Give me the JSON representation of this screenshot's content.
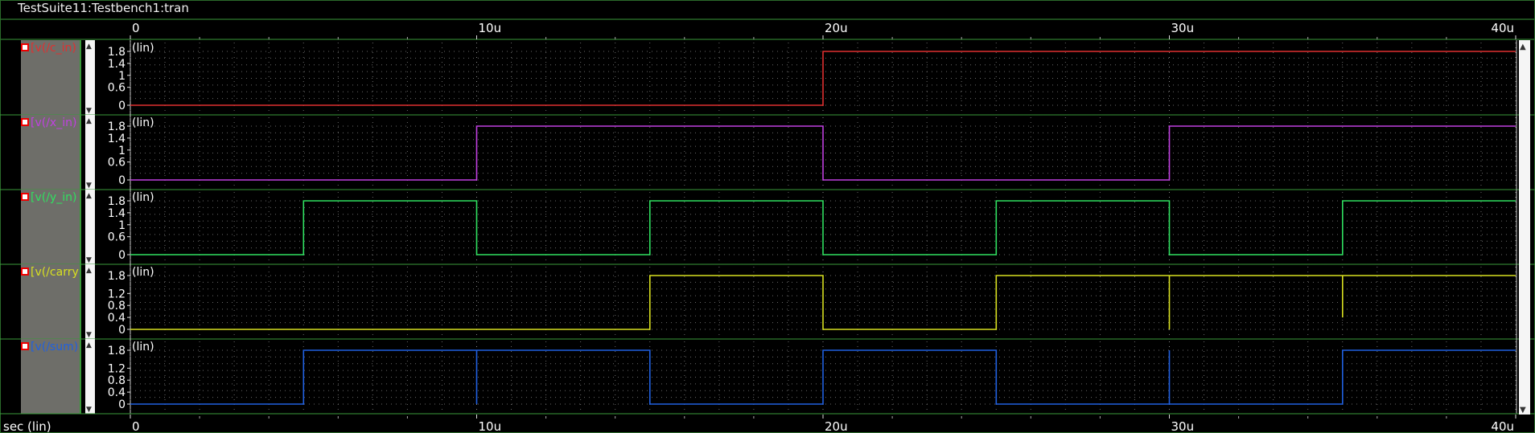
{
  "window": {
    "title": "TestSuite11:Testbench1:tran",
    "x_axis_label": "sec (lin)",
    "background": "#000000",
    "grid_color": "#6a6a6a",
    "frame_color": "#3a9a3a",
    "name_column_color": "#6e6e69"
  },
  "chart_data": {
    "type": "line",
    "x_ticks": [
      0,
      10,
      20,
      30,
      40
    ],
    "x_tick_labels": [
      "0",
      "10u",
      "20u",
      "30u",
      "40u"
    ],
    "xlim": [
      0,
      40
    ],
    "x_unit": "us",
    "strips": [
      {
        "name": "[v(/c_in)",
        "color": "#e03030",
        "scale_label": "(lin)",
        "ylim": [
          0,
          1.8
        ],
        "y_ticks": [
          1.8,
          1.4,
          1,
          0.6,
          0
        ],
        "y_tick_labels": [
          "1.8",
          "1.4",
          "1",
          "0.6",
          "0"
        ],
        "points": [
          [
            0,
            0
          ],
          [
            20,
            0
          ],
          [
            20,
            1.8
          ],
          [
            40,
            1.8
          ]
        ]
      },
      {
        "name": "[v(/x_in)",
        "color": "#c040e0",
        "scale_label": "(lin)",
        "ylim": [
          0,
          1.8
        ],
        "y_ticks": [
          1.8,
          1.4,
          1,
          0.6,
          0
        ],
        "y_tick_labels": [
          "1.8",
          "1.4",
          "1",
          "0.6",
          "0"
        ],
        "points": [
          [
            0,
            0
          ],
          [
            10,
            0
          ],
          [
            10,
            1.8
          ],
          [
            20,
            1.8
          ],
          [
            20,
            0
          ],
          [
            30,
            0
          ],
          [
            30,
            1.8
          ],
          [
            40,
            1.8
          ]
        ]
      },
      {
        "name": "[v(/y_in)",
        "color": "#30e060",
        "scale_label": "(lin)",
        "ylim": [
          0,
          1.8
        ],
        "y_ticks": [
          1.8,
          1.4,
          1,
          0.6,
          0
        ],
        "y_tick_labels": [
          "1.8",
          "1.4",
          "1",
          "0.6",
          "0"
        ],
        "points": [
          [
            0,
            0
          ],
          [
            5,
            0
          ],
          [
            5,
            1.8
          ],
          [
            10,
            1.8
          ],
          [
            10,
            0
          ],
          [
            15,
            0
          ],
          [
            15,
            1.8
          ],
          [
            20,
            1.8
          ],
          [
            20,
            0
          ],
          [
            25,
            0
          ],
          [
            25,
            1.8
          ],
          [
            30,
            1.8
          ],
          [
            30,
            0
          ],
          [
            35,
            0
          ],
          [
            35,
            1.8
          ],
          [
            40,
            1.8
          ]
        ]
      },
      {
        "name": "[v(/carry",
        "color": "#d8e020",
        "scale_label": "(lin)",
        "ylim": [
          0,
          1.8
        ],
        "y_ticks": [
          1.8,
          1.2,
          0.8,
          0.4,
          0
        ],
        "y_tick_labels": [
          "1.8",
          "1.2",
          "0.8",
          "0.4",
          "0"
        ],
        "points": [
          [
            0,
            0
          ],
          [
            15,
            0
          ],
          [
            15,
            1.8
          ],
          [
            20,
            1.8
          ],
          [
            20,
            0
          ],
          [
            25,
            0
          ],
          [
            25,
            1.8
          ],
          [
            30,
            1.8
          ],
          [
            30,
            0
          ],
          [
            30,
            1.8
          ],
          [
            35,
            1.8
          ],
          [
            35,
            0.4
          ],
          [
            35,
            1.8
          ],
          [
            40,
            1.8
          ]
        ]
      },
      {
        "name": "[v(/sum)",
        "color": "#2060e0",
        "scale_label": "(lin)",
        "ylim": [
          0,
          1.8
        ],
        "y_ticks": [
          1.8,
          1.2,
          0.8,
          0.4,
          0
        ],
        "y_tick_labels": [
          "1.8",
          "1.2",
          "0.8",
          "0.4",
          "0"
        ],
        "points": [
          [
            0,
            0
          ],
          [
            5,
            0
          ],
          [
            5,
            1.8
          ],
          [
            10,
            1.8
          ],
          [
            10,
            0
          ],
          [
            10,
            1.8
          ],
          [
            15,
            1.8
          ],
          [
            15,
            0
          ],
          [
            20,
            0
          ],
          [
            20,
            1.8
          ],
          [
            25,
            1.8
          ],
          [
            25,
            0
          ],
          [
            30,
            0
          ],
          [
            30,
            1.8
          ],
          [
            30,
            0
          ],
          [
            35,
            0
          ],
          [
            35,
            1.8
          ],
          [
            40,
            1.8
          ]
        ]
      }
    ]
  }
}
